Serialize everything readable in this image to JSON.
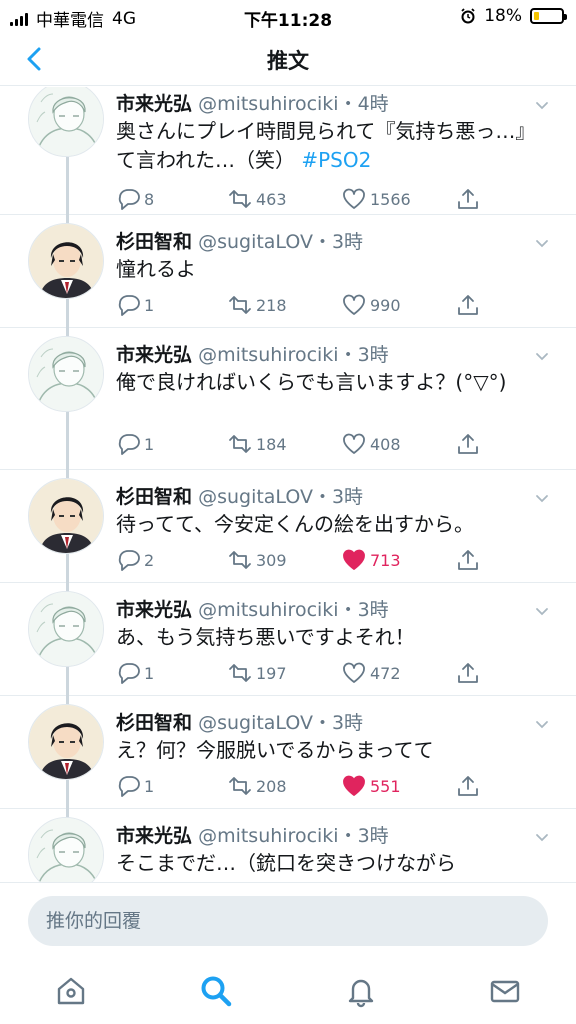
{
  "status_bar": {
    "carrier": "中華電信",
    "network": "4G",
    "time": "下午11:28",
    "battery_text": "18%",
    "battery_level": 0.18
  },
  "nav": {
    "title": "推文",
    "back_icon": "chevron-left-icon"
  },
  "colors": {
    "accent": "#1da1f2",
    "like": "#e0245e",
    "text": "#14171a",
    "muted": "#657786",
    "battery": "#f5c400"
  },
  "tweets": [
    {
      "name": "市来光弘",
      "handle": "@mitsuhirociki",
      "time": "・4時",
      "text": "奥さんにプレイ時間見られて『気持ち悪っ…』て言われた…（笑）",
      "hashtag": "#PSO2",
      "replies": "8",
      "retweets": "463",
      "likes": "1566",
      "liked": false,
      "avatar": "light"
    },
    {
      "name": "杉田智和",
      "handle": "@sugitaLOV",
      "time": "・3時",
      "text": "憧れるよ",
      "hashtag": "",
      "replies": "1",
      "retweets": "218",
      "likes": "990",
      "liked": false,
      "avatar": "dark"
    },
    {
      "name": "市来光弘",
      "handle": "@mitsuhirociki",
      "time": "・3時",
      "text": "俺で良ければいくらでも言いますよ？(°▽°)",
      "hashtag": "",
      "replies": "1",
      "retweets": "184",
      "likes": "408",
      "liked": false,
      "avatar": "light"
    },
    {
      "name": "杉田智和",
      "handle": "@sugitaLOV",
      "time": "・3時",
      "text": "待ってて、今安定くんの絵を出すから。",
      "hashtag": "",
      "replies": "2",
      "retweets": "309",
      "likes": "713",
      "liked": true,
      "avatar": "dark"
    },
    {
      "name": "市来光弘",
      "handle": "@mitsuhirociki",
      "time": "・3時",
      "text": "あ、もう気持ち悪いですよそれ！",
      "hashtag": "",
      "replies": "1",
      "retweets": "197",
      "likes": "472",
      "liked": false,
      "avatar": "light"
    },
    {
      "name": "杉田智和",
      "handle": "@sugitaLOV",
      "time": "・3時",
      "text": "え？何？今服脱いでるからまってて",
      "hashtag": "",
      "replies": "1",
      "retweets": "208",
      "likes": "551",
      "liked": true,
      "avatar": "dark"
    },
    {
      "name": "市来光弘",
      "handle": "@mitsuhirociki",
      "time": "・3時",
      "text": "そこまでだ…（銃口を突きつけながら",
      "hashtag": "",
      "replies": "",
      "retweets": "",
      "likes": "",
      "liked": false,
      "avatar": "light"
    }
  ],
  "reply": {
    "placeholder": "推你的回覆"
  },
  "tabs": [
    {
      "icon": "home-icon",
      "active": false
    },
    {
      "icon": "search-icon",
      "active": true
    },
    {
      "icon": "notifications-icon",
      "active": false
    },
    {
      "icon": "messages-icon",
      "active": false
    }
  ]
}
